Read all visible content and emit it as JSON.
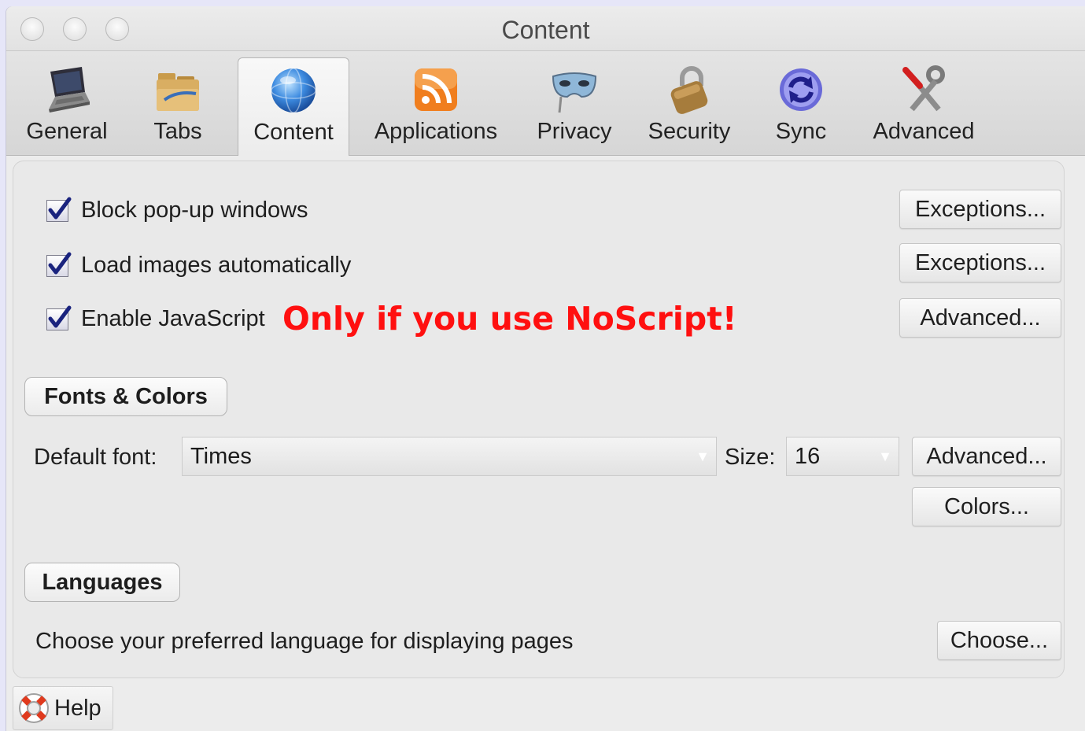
{
  "window": {
    "title": "Content"
  },
  "toolbar": {
    "items": [
      {
        "label": "General",
        "icon": "laptop-icon"
      },
      {
        "label": "Tabs",
        "icon": "folder-tabs-icon"
      },
      {
        "label": "Content",
        "icon": "globe-icon",
        "selected": true
      },
      {
        "label": "Applications",
        "icon": "rss-feed-icon"
      },
      {
        "label": "Privacy",
        "icon": "mask-icon"
      },
      {
        "label": "Security",
        "icon": "padlock-icon"
      },
      {
        "label": "Sync",
        "icon": "sync-arrows-icon"
      },
      {
        "label": "Advanced",
        "icon": "tools-icon"
      }
    ]
  },
  "content": {
    "block_popups": {
      "label": "Block pop-up windows",
      "checked": true,
      "button": "Exceptions..."
    },
    "load_images": {
      "label": "Load images automatically",
      "checked": true,
      "button": "Exceptions..."
    },
    "enable_js": {
      "label": "Enable JavaScript",
      "checked": true,
      "button": "Advanced..."
    },
    "annotation": "Only if you use NoScript!",
    "fonts": {
      "section_label": "Fonts & Colors",
      "default_font_label": "Default font:",
      "default_font_value": "Times",
      "size_label": "Size:",
      "size_value": "16",
      "advanced_button": "Advanced...",
      "colors_button": "Colors..."
    },
    "languages": {
      "section_label": "Languages",
      "description": "Choose your preferred language for displaying pages",
      "choose_button": "Choose..."
    }
  },
  "footer": {
    "help_label": "Help"
  },
  "colors": {
    "annotation": "#ff1010",
    "checkmark": "#1a237e",
    "background": "#e6e6f8"
  }
}
